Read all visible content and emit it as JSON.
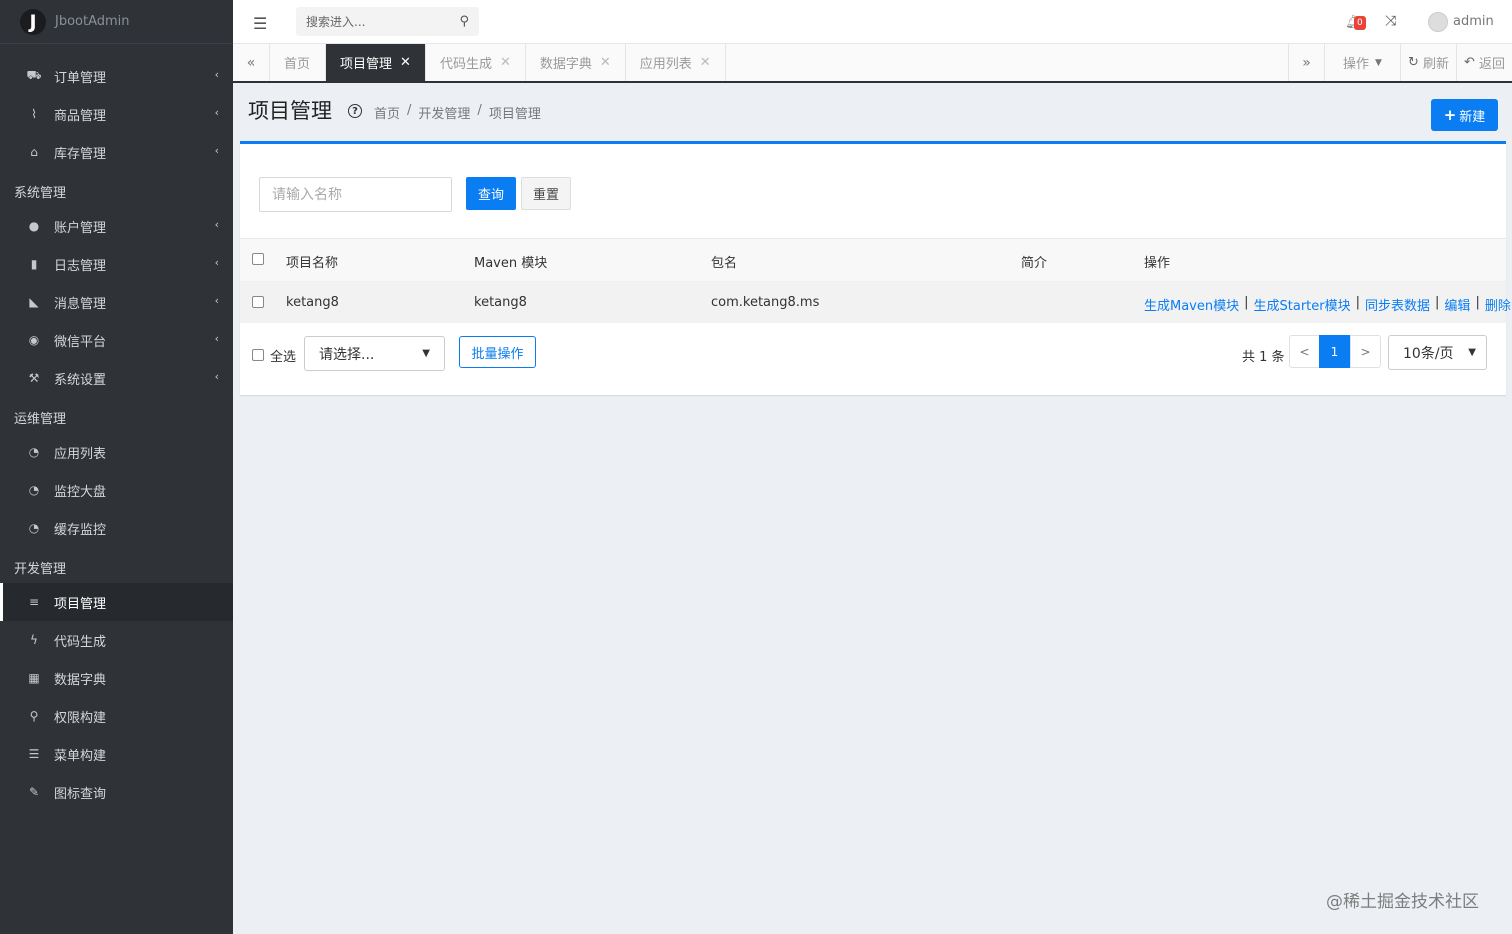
{
  "brand": {
    "logo": "J",
    "name": "JbootAdmin"
  },
  "sidebar": {
    "group1": [
      {
        "label": "订单管理",
        "icon": "cart-icon",
        "glyph": "🛒"
      },
      {
        "label": "商品管理",
        "icon": "paperclip-icon",
        "glyph": "📎"
      },
      {
        "label": "库存管理",
        "icon": "bank-icon",
        "glyph": "🏛"
      }
    ],
    "header_system": "系统管理",
    "group2": [
      {
        "label": "账户管理",
        "icon": "user-icon",
        "glyph": "👤"
      },
      {
        "label": "日志管理",
        "icon": "book-icon",
        "glyph": "📕"
      },
      {
        "label": "消息管理",
        "icon": "rss-icon",
        "glyph": "📡"
      },
      {
        "label": "微信平台",
        "icon": "wechat-icon",
        "glyph": "💬"
      },
      {
        "label": "系统设置",
        "icon": "wrench-icon",
        "glyph": "🔧"
      }
    ],
    "header_ops": "运维管理",
    "group3": [
      {
        "label": "应用列表",
        "icon": "dashboard-icon",
        "glyph": "◔"
      },
      {
        "label": "监控大盘",
        "icon": "dashboard-icon",
        "glyph": "◔"
      },
      {
        "label": "缓存监控",
        "icon": "dashboard-icon",
        "glyph": "◔"
      }
    ],
    "header_dev": "开发管理",
    "group4": [
      {
        "label": "项目管理",
        "icon": "database-icon",
        "glyph": "≡",
        "active": true
      },
      {
        "label": "代码生成",
        "icon": "bolt-icon",
        "glyph": "ϟ"
      },
      {
        "label": "数据字典",
        "icon": "grid-icon",
        "glyph": "▦"
      },
      {
        "label": "权限构建",
        "icon": "sitemap-icon",
        "glyph": "⚲"
      },
      {
        "label": "菜单构建",
        "icon": "list-icon",
        "glyph": "☰"
      },
      {
        "label": "图标查询",
        "icon": "pencil-icon",
        "glyph": "✎"
      }
    ],
    "chevron": "‹"
  },
  "topbar": {
    "search_placeholder": "搜索进入...",
    "notification_count": "0",
    "username": "admin"
  },
  "tabs": {
    "items": [
      {
        "label": "首页",
        "closable": false
      },
      {
        "label": "项目管理",
        "closable": true,
        "active": true
      },
      {
        "label": "代码生成",
        "closable": true
      },
      {
        "label": "数据字典",
        "closable": true
      },
      {
        "label": "应用列表",
        "closable": true
      }
    ],
    "ops_label": "操作",
    "refresh_label": "刷新",
    "back_label": "返回"
  },
  "page": {
    "title": "项目管理",
    "breadcrumb": [
      "首页",
      "开发管理",
      "项目管理"
    ],
    "new_button": "新建"
  },
  "filter": {
    "name_placeholder": "请输入名称",
    "query_label": "查询",
    "reset_label": "重置"
  },
  "table": {
    "columns": [
      "项目名称",
      "Maven 模块",
      "包名",
      "简介",
      "操作"
    ],
    "rows": [
      {
        "name": "ketang8",
        "maven_module": "ketang8",
        "package": "com.ketang8.ms",
        "desc": "",
        "actions": [
          "生成Maven模块",
          "生成Starter模块",
          "同步表数据",
          "编辑",
          "删除"
        ]
      }
    ]
  },
  "footer": {
    "select_all": "全选",
    "batch_select": "请选择...",
    "batch_button": "批量操作",
    "total": "共 1 条",
    "prev": "<",
    "current_page": "1",
    "next": ">",
    "page_size": "10条/页"
  },
  "watermark": "@稀土掘金技术社区",
  "colors": {
    "sidebar_bg": "#2f3237",
    "primary": "#0a7df3",
    "badge": "#e8443a",
    "content_bg": "#ecf0f5"
  }
}
